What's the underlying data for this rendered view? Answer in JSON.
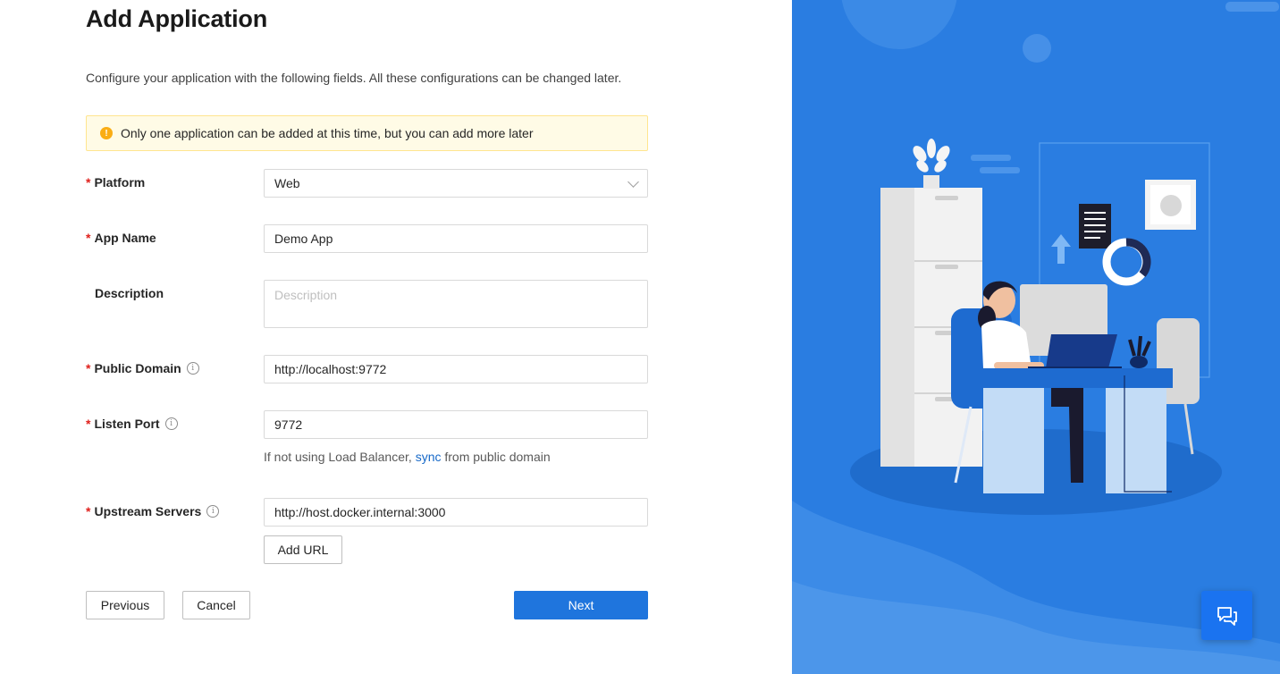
{
  "page": {
    "title": "Add Application",
    "intro": "Configure your application with the following fields. All these configurations can be changed later."
  },
  "alert": {
    "icon": "warning-icon",
    "text": "Only one application can be added at this time, but you can add more later"
  },
  "form": {
    "platform": {
      "label": "Platform",
      "required": true,
      "value": "Web"
    },
    "app_name": {
      "label": "App Name",
      "required": true,
      "value": "Demo App"
    },
    "description": {
      "label": "Description",
      "required": false,
      "value": "",
      "placeholder": "Description"
    },
    "public_domain": {
      "label": "Public Domain",
      "required": true,
      "value": "http://localhost:9772"
    },
    "listen_port": {
      "label": "Listen Port",
      "required": true,
      "value": "9772",
      "help_prefix": "If not using Load Balancer,",
      "help_link": "sync",
      "help_suffix": "from public domain"
    },
    "upstream_servers": {
      "label": "Upstream Servers",
      "required": true,
      "value": "http://host.docker.internal:3000",
      "add_url_label": "Add URL"
    }
  },
  "actions": {
    "previous_label": "Previous",
    "cancel_label": "Cancel",
    "next_label": "Next"
  },
  "colors": {
    "primary": "#1f75dd",
    "illustration_bg": "#2a7de1",
    "required_mark": "#e0201c",
    "alert_bg": "#fffbe6",
    "alert_border": "#ffe58f"
  },
  "icons": {
    "select_arrow": "chevron-down-icon",
    "info": "info-icon",
    "chat": "chat-icon"
  }
}
